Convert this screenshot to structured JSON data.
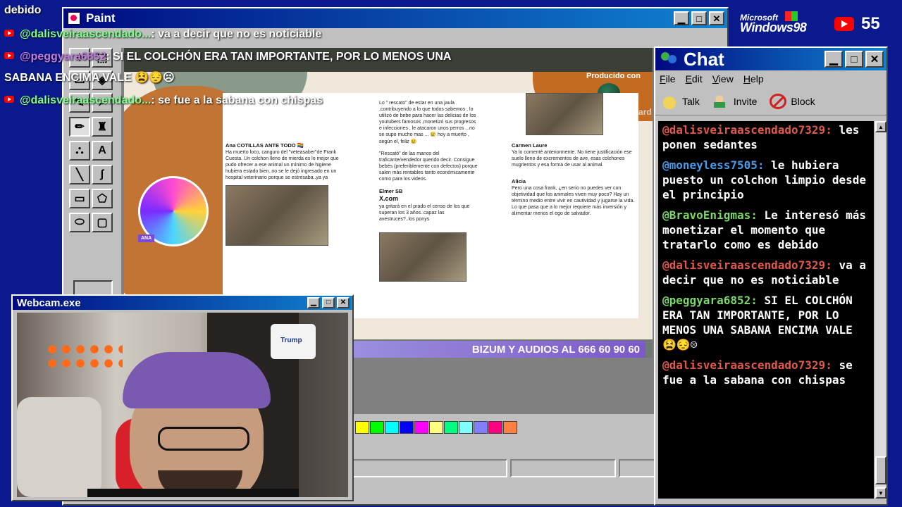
{
  "overlay": {
    "line0": "debido",
    "line1": {
      "user": "@dalisveiraascendado...",
      "text": ": va a decir que no es noticiable"
    },
    "line2": {
      "user": "@peggyara6852",
      "text": ": SI EL COLCHÓN ERA TAN IMPORTANTE, POR LO MENOS UNA"
    },
    "line3": "SABANA ENCIMA VALE 😫😔☹",
    "line4": {
      "user": "@dalisveiraascendado...",
      "text": ": se fue a la sabana con chispas"
    }
  },
  "paint": {
    "title": "Paint",
    "palette": [
      "#ffff00",
      "#00ff00",
      "#00ffff",
      "#0000ff",
      "#ff00ff",
      "#ffff80",
      "#00ff80",
      "#80ffff",
      "#8080ff",
      "#ff0080",
      "#ff8040"
    ]
  },
  "share": {
    "producido": "Producido con",
    "streamyard": "StreamYard",
    "bizum": "BIZUM Y AUDIOS AL 666 60 90 60",
    "ana_badge": "ANA",
    "tweet1_name": "Ana COTILLAS ANTE TODO 🏳️‍🌈",
    "tweet1_text": "Ha muerto loco, canguro del \"veteasaber\"de Frank Cuesta. Un colchon lleno de mierda es lo mejor que pudo ofrecer a ese animal un mínimo de higiene hubiera estado bien..no se le dejó ingresado en un hospital veterinario porque se estresaba..ya ya",
    "tweet2_text": "Lo \" rescato\" de estar en una jaula ,contribuyendo a lo que todos sabemos , lo utilizó de bebe para hacer las delicias de los youtubers famosos ,monetizó sus progresos e infecciones , le atacaron unos perros ...no se supo mucho mas ... 😢 hoy a muerto , según el, feliz 😢",
    "tweet3_text": "\"Rescató\" de las manos del traficante/vendedor querido decir. Consigue bebés (preferiblemente con defectos) porque salen más rentables tanto económicamente como para los videos.",
    "tweet4_name": "Elmer SB",
    "tweet4_text": "ya gritará en el prado el censo de los que superan los 3 años..capaz las avestruces?..los ponys",
    "tweet5_name": "Carmen Laure",
    "tweet5_text": "Ya lo comenté anteriormente. No tiene justificación ese suelo lleno de excrementos de ave, esas colchones mugrientos y esa forma de usar al animal.",
    "tweet6_name": "Alicia",
    "tweet6_text": "Pero una cosa frank, ¿en serio no puedes ver con objetividad que los animales viven muy poco? Hay un término medio entre vivir en cautividad y jugarse la vida. Lo que pasa que a lo mejor requiere más inversión y alimentar menos el ego de salvador.",
    "xcom": "X.com"
  },
  "brand": {
    "ms": "Microsoft",
    "win98": "Windows98",
    "viewers": "55"
  },
  "chat": {
    "title": "Chat",
    "menu": [
      "File",
      "Edit",
      "View",
      "Help"
    ],
    "toolbar": {
      "talk": "Talk",
      "invite": "Invite",
      "block": "Block"
    },
    "messages": [
      {
        "user": "@dalisveiraascendado7329:",
        "text": "les ponen sedantes",
        "color": "#e05a4a"
      },
      {
        "user": "@moneyless7505:",
        "text": "le hubiera puesto un colchon limpio desde el principio",
        "color": "#4a9ae8"
      },
      {
        "user": "@BravoEnigmas:",
        "text": "Le interesó más monetizar el momento que tratarlo como es debido",
        "color": "#7ad86a"
      },
      {
        "user": "@dalisveiraascendado7329:",
        "text": "va a decir que no es noticiable",
        "color": "#e05a4a"
      },
      {
        "user": "@peggyara6852:",
        "text": "SI EL COLCHÓN ERA TAN IMPORTANTE, POR LO MENOS UNA SABANA ENCIMA VALE 😫😔☹",
        "color": "#7ad86a"
      },
      {
        "user": "@dalisveiraascendado7329:",
        "text": "se fue a la sabana con chispas",
        "color": "#e05a4a"
      }
    ]
  },
  "webcam": {
    "title": "Webcam.exe",
    "rolls": "Trump"
  }
}
